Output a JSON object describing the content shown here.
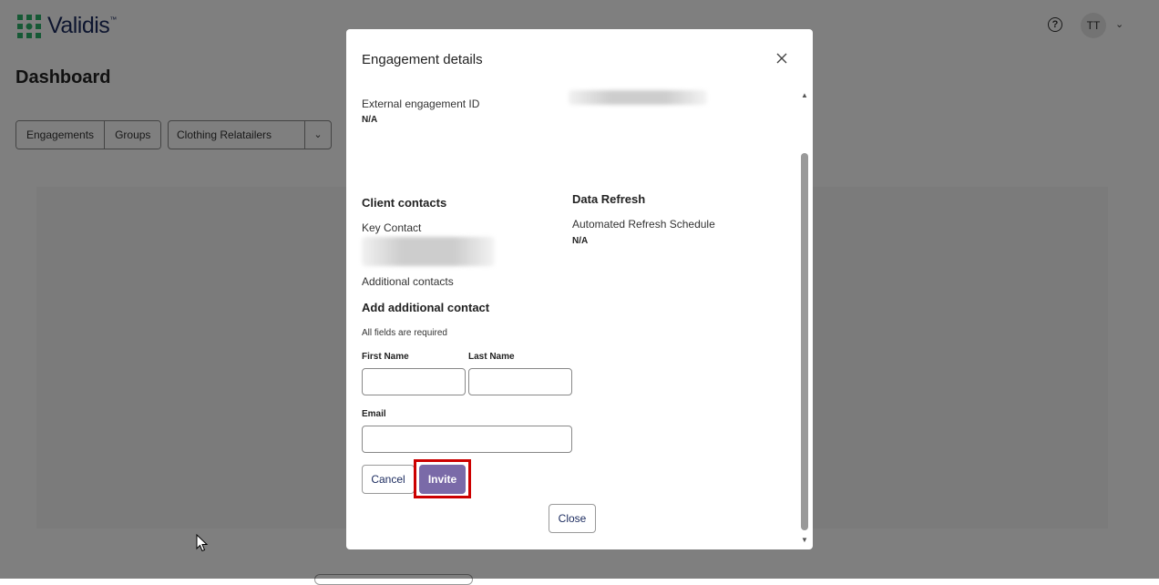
{
  "app": {
    "logo_text": "Validis",
    "logo_tm": "™",
    "brand_color": "#2db36b",
    "avatar_initials": "TT",
    "page_title": "Dashboard",
    "tabs": [
      {
        "label": "Engagements"
      },
      {
        "label": "Groups"
      }
    ],
    "group_select_value": "Clothing Relatailers"
  },
  "modal": {
    "title": "Engagement details",
    "external_id_label": "External engagement ID",
    "external_id_value": "N/A",
    "client_contacts_heading": "Client contacts",
    "key_contact_label": "Key Contact",
    "data_refresh_heading": "Data Refresh",
    "refresh_schedule_label": "Automated Refresh Schedule",
    "refresh_schedule_value": "N/A",
    "additional_contacts_label": "Additional contacts",
    "add_contact_heading": "Add additional contact",
    "required_note": "All fields are required",
    "first_name_label": "First Name",
    "first_name_value": "",
    "last_name_label": "Last Name",
    "last_name_value": "",
    "email_label": "Email",
    "email_value": "",
    "cancel_label": "Cancel",
    "invite_label": "Invite",
    "close_label": "Close",
    "invite_color": "#7a6aa8",
    "highlight_color": "#cc0000"
  }
}
